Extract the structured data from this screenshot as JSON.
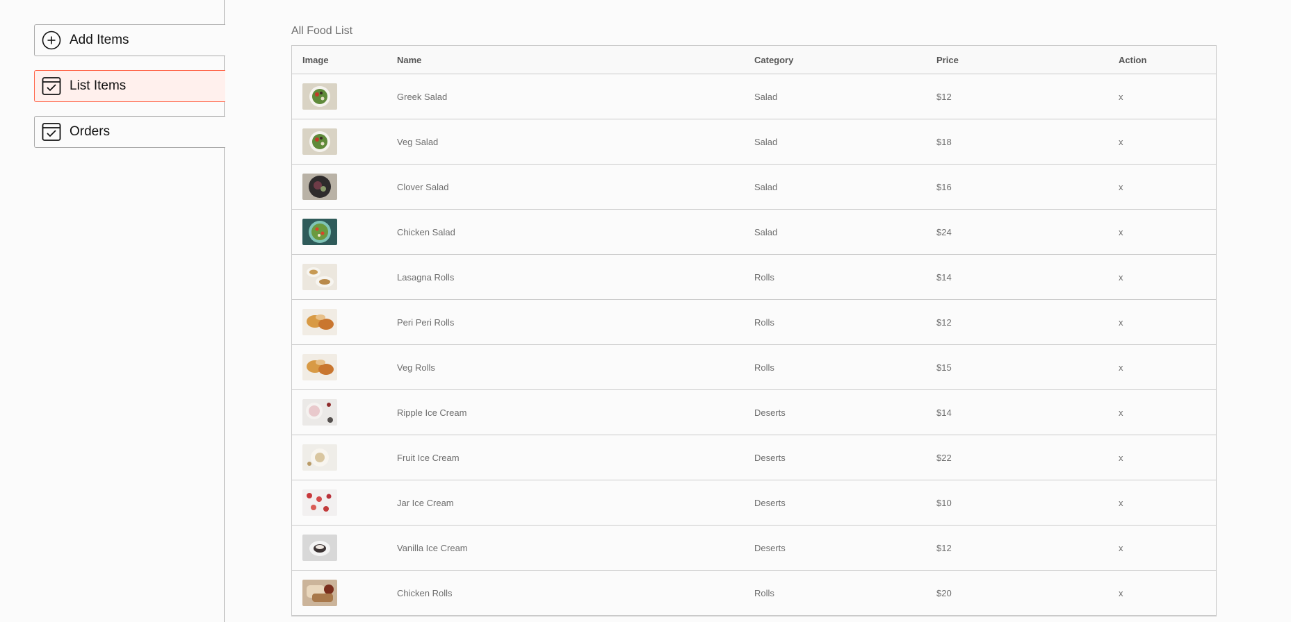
{
  "sidebar": {
    "items": [
      {
        "label": "Add Items",
        "icon": "add-circle-icon",
        "active": false
      },
      {
        "label": "List Items",
        "icon": "calendar-check-icon",
        "active": true
      },
      {
        "label": "Orders",
        "icon": "calendar-check-icon",
        "active": false
      }
    ]
  },
  "main": {
    "title": "All Food List",
    "table": {
      "headers": [
        "Image",
        "Name",
        "Category",
        "Price",
        "Action"
      ],
      "rows": [
        {
          "name": "Greek Salad",
          "category": "Salad",
          "price": "$12",
          "action": "x",
          "thumb": "green-salad"
        },
        {
          "name": "Veg Salad",
          "category": "Salad",
          "price": "$18",
          "action": "x",
          "thumb": "green-salad"
        },
        {
          "name": "Clover Salad",
          "category": "Salad",
          "price": "$16",
          "action": "x",
          "thumb": "dark-salad"
        },
        {
          "name": "Chicken Salad",
          "category": "Salad",
          "price": "$24",
          "action": "x",
          "thumb": "teal-salad"
        },
        {
          "name": "Lasagna Rolls",
          "category": "Rolls",
          "price": "$14",
          "action": "x",
          "thumb": "rolls"
        },
        {
          "name": "Peri Peri Rolls",
          "category": "Rolls",
          "price": "$12",
          "action": "x",
          "thumb": "orange-rolls"
        },
        {
          "name": "Veg Rolls",
          "category": "Rolls",
          "price": "$15",
          "action": "x",
          "thumb": "orange-rolls"
        },
        {
          "name": "Ripple Ice Cream",
          "category": "Deserts",
          "price": "$14",
          "action": "x",
          "thumb": "ice-cream"
        },
        {
          "name": "Fruit Ice Cream",
          "category": "Deserts",
          "price": "$22",
          "action": "x",
          "thumb": "beige"
        },
        {
          "name": "Jar Ice Cream",
          "category": "Deserts",
          "price": "$10",
          "action": "x",
          "thumb": "red-dots"
        },
        {
          "name": "Vanilla Ice Cream",
          "category": "Deserts",
          "price": "$12",
          "action": "x",
          "thumb": "grey"
        },
        {
          "name": "Chicken Rolls",
          "category": "Rolls",
          "price": "$20",
          "action": "x",
          "thumb": "brown-rolls"
        }
      ]
    }
  },
  "colors": {
    "accent": "#ff6347",
    "active_bg": "#fff0ed",
    "border": "#cacaca",
    "text": "#6d6d6d"
  }
}
